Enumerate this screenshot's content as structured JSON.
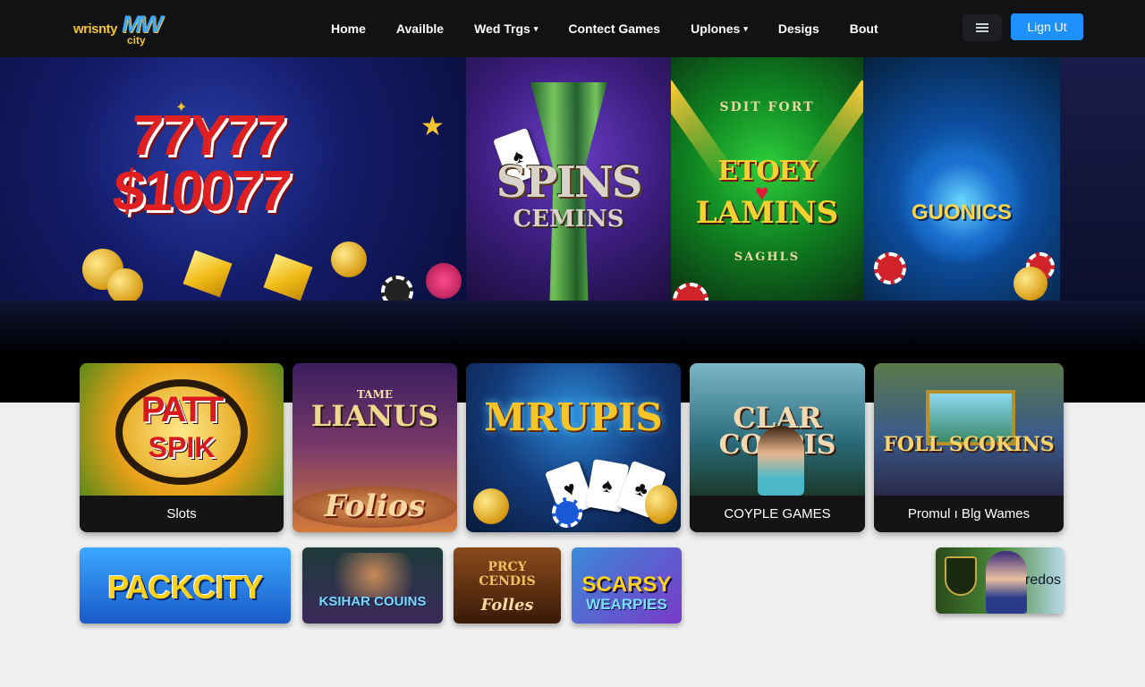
{
  "header": {
    "logo": {
      "text": "wrisnty",
      "mark": "MW",
      "sub": "city"
    },
    "nav": [
      {
        "label": "Home",
        "has_dropdown": false
      },
      {
        "label": "Availble",
        "has_dropdown": false
      },
      {
        "label": "Wed Trgs",
        "has_dropdown": true
      },
      {
        "label": "Contect Games",
        "has_dropdown": false
      },
      {
        "label": "Uplones",
        "has_dropdown": true
      },
      {
        "label": "Desigs",
        "has_dropdown": false
      },
      {
        "label": "Bout",
        "has_dropdown": false
      }
    ],
    "menu_icon": "grid-menu-icon",
    "signin_label": "Lign Ut"
  },
  "hero": {
    "panels": [
      {
        "title_line1": "77Y77",
        "title_line2": "$10077",
        "icon": "slot-sevens"
      },
      {
        "title_line1": "SPINS",
        "title_line2": "CEMINS",
        "icon": "playing-card"
      },
      {
        "title_top": "SDIT FORT",
        "title_line1": "ETOEY",
        "title_line2": "LAMINS",
        "title_bottom": "SAGHLS",
        "icon": "heart"
      },
      {
        "title_line1": "GUONICS",
        "icon": "glowing-orb"
      }
    ]
  },
  "games": {
    "featured": [
      {
        "art_title_1": "PATT",
        "art_title_2": "SPIK",
        "label": "Slots"
      },
      {
        "art_title_1": "LIANUS",
        "art_title_0": "TAME",
        "art_title_2": "Folios",
        "label": ""
      },
      {
        "art_title_1": "MRUPIS",
        "label": ""
      },
      {
        "art_title_1": "CLAR",
        "art_title_2": "COPPIS",
        "label": "COYPLE GAMES"
      },
      {
        "art_title_1": "FOLL SCOKINS",
        "label": "Promul ı Blg Wames"
      }
    ],
    "small": [
      {
        "art_title": "PACKCITY"
      },
      {
        "art_title": "KSIHAR COUINS"
      },
      {
        "art_title_1": "PRCY",
        "art_title_2": "CENDIS",
        "art_title_3": "Folles"
      },
      {
        "art_title_1": "SCARSY",
        "art_title_2": "WEARPIES"
      },
      {
        "art_title": "redos"
      }
    ]
  },
  "colors": {
    "nav_bg": "#111214",
    "accent": "#1e90ff",
    "page_bg": "#efefef",
    "gold": "#f4c430"
  }
}
